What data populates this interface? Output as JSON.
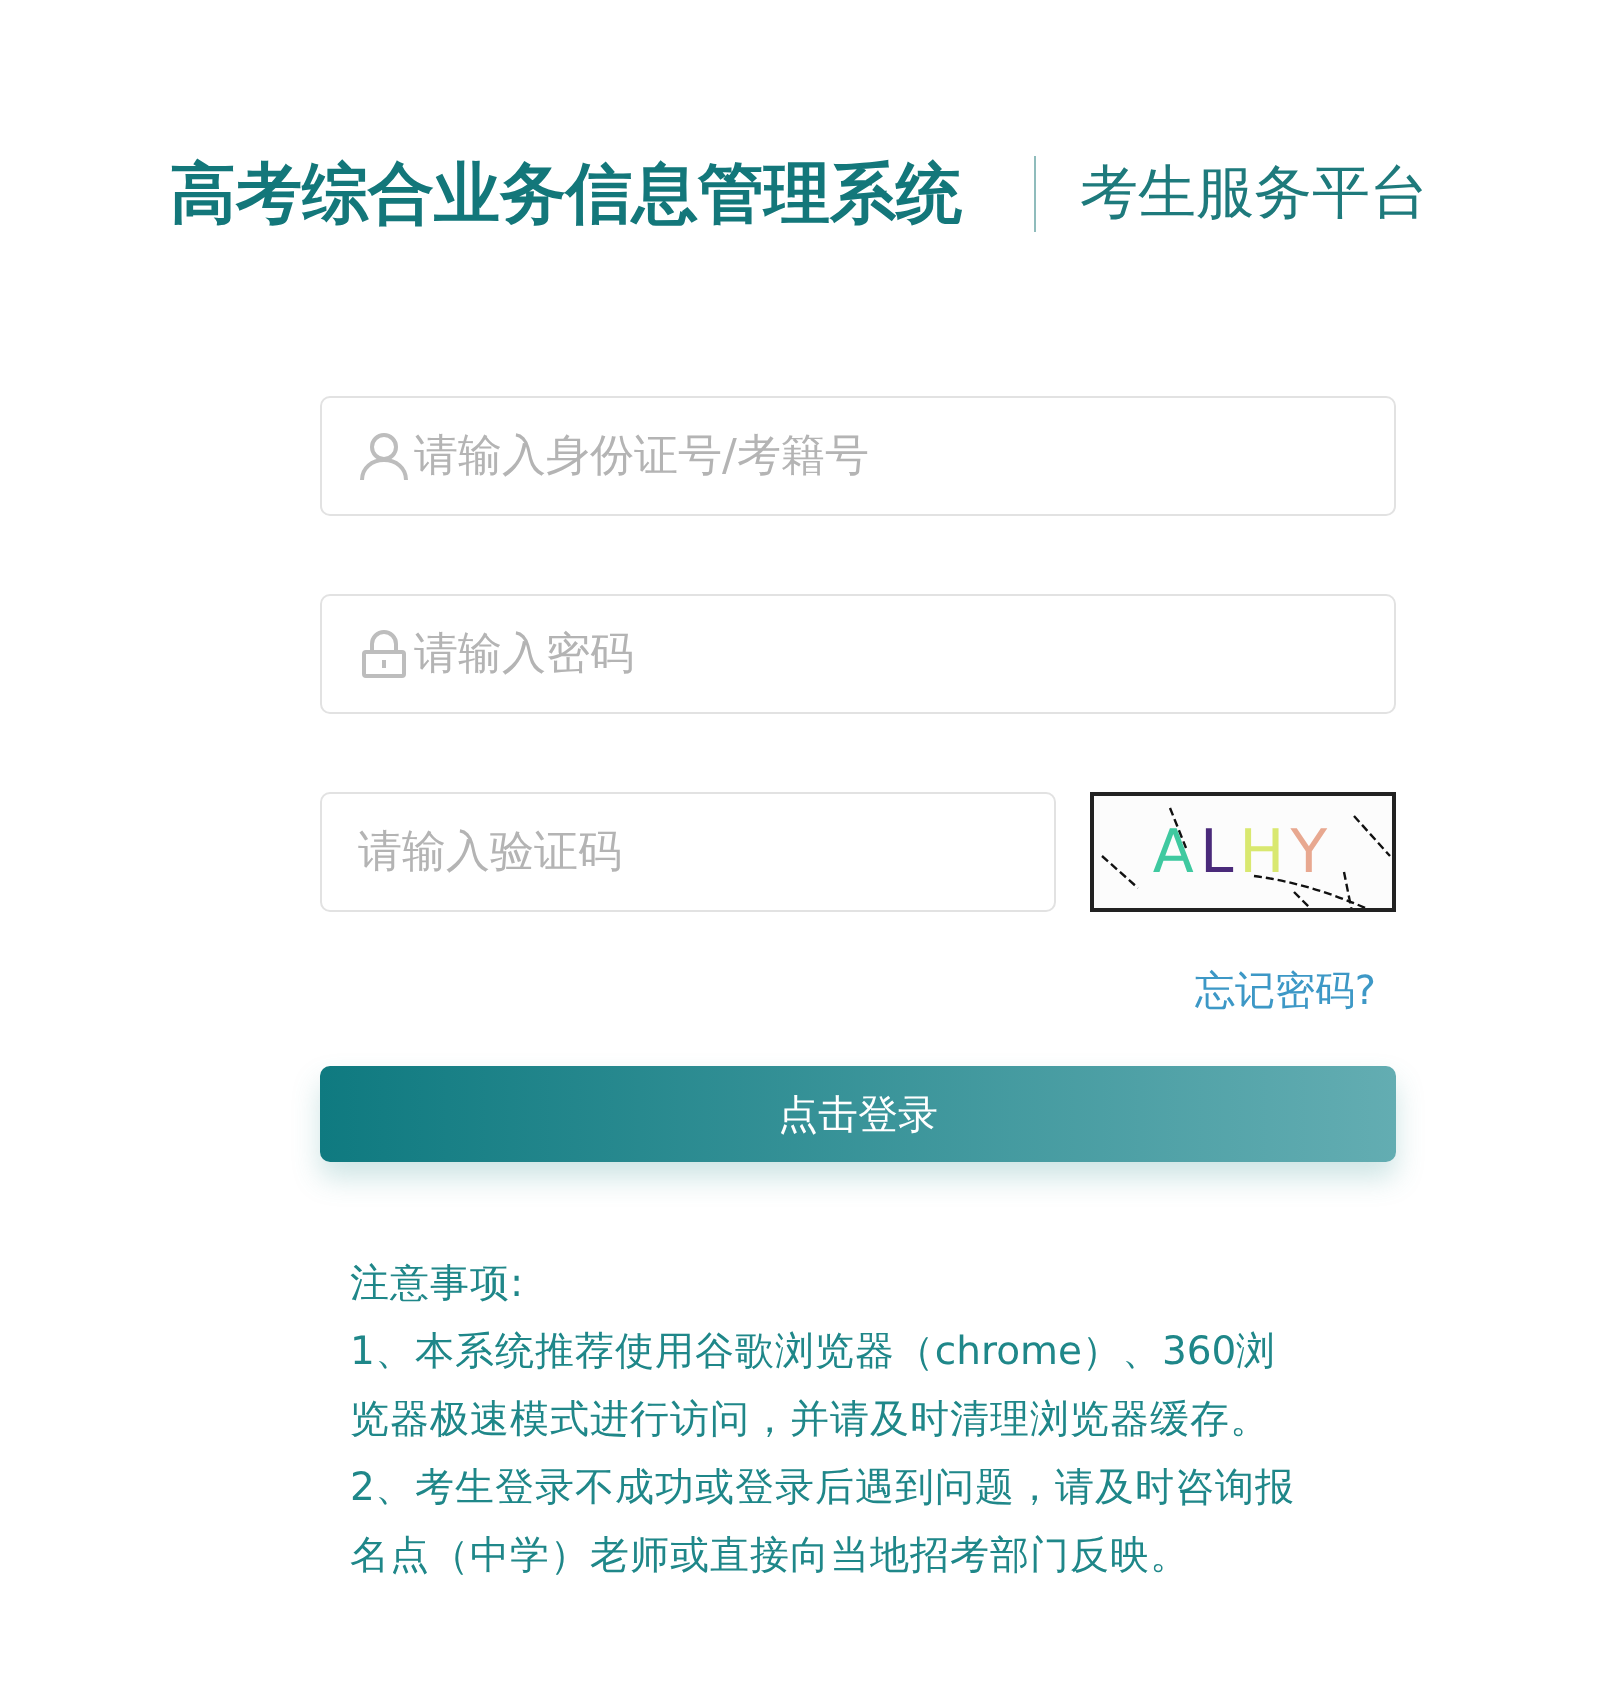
{
  "header": {
    "title": "高考综合业务信息管理系统",
    "subtitle": "考生服务平台"
  },
  "form": {
    "fields": [
      {
        "kind": "user",
        "placeholder": "请输入身份证号/考籍号"
      },
      {
        "kind": "password",
        "placeholder": "请输入密码"
      },
      {
        "kind": "captcha",
        "placeholder": "请输入验证码"
      }
    ],
    "captcha_text": "ALHY",
    "forgot_link": "忘记密码?",
    "submit_button": "点击登录"
  },
  "notes": {
    "title": "注意事项:",
    "items": [
      "1、本系统推荐使用谷歌浏览器（chrome）、360浏览器极速模式进行访问，并请及时清理浏览器缓存。",
      "2、考生登录不成功或登录后遇到问题，请及时咨询报名点（中学）老师或直接向当地招考部门反映。"
    ]
  }
}
